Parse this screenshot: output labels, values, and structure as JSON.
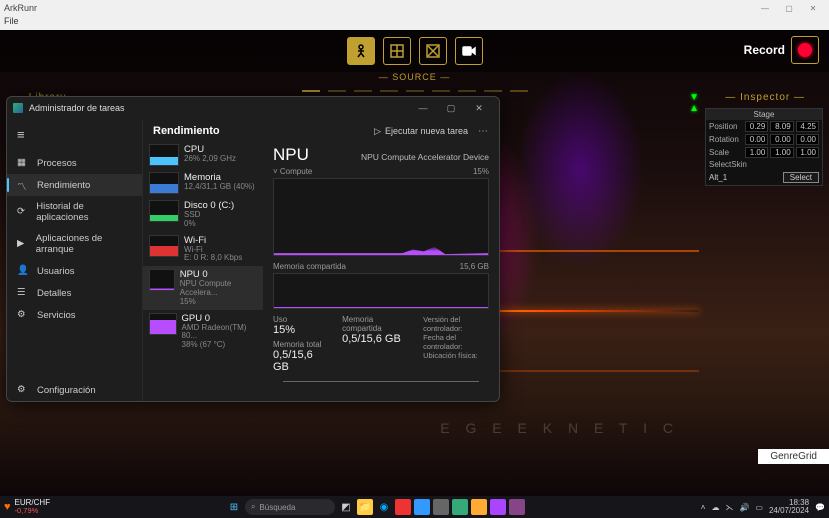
{
  "outer": {
    "title": "ArkRunr",
    "menu_file": "File"
  },
  "app": {
    "source": "— SOURCE —",
    "record": "Record",
    "library": "Library",
    "inspector": "Inspector",
    "watermark": "E   G E E K N E T I C",
    "genregrid": "GenreGrid"
  },
  "inspector": {
    "title": "Stage",
    "rows": [
      {
        "lbl": "Position",
        "v": [
          "0.29",
          "8.09",
          "4.25"
        ]
      },
      {
        "lbl": "Rotation",
        "v": [
          "0.00",
          "0.00",
          "0.00"
        ]
      },
      {
        "lbl": "Scale",
        "v": [
          "1.00",
          "1.00",
          "1.00"
        ]
      }
    ],
    "selectskin": "SelectSkin",
    "alt": "Alt_1",
    "select": "Select"
  },
  "tm": {
    "title": "Administrador de tareas",
    "head": "Rendimiento",
    "run": "Ejecutar nueva tarea",
    "nav": [
      "Procesos",
      "Rendimiento",
      "Historial de aplicaciones",
      "Aplicaciones de arranque",
      "Usuarios",
      "Detalles",
      "Servicios"
    ],
    "settings": "Configuración",
    "list": [
      {
        "t": "CPU",
        "s": "26%  2,09 GHz",
        "c": "cpu"
      },
      {
        "t": "Memoria",
        "s": "12,4/31,1 GB (40%)",
        "c": "mem"
      },
      {
        "t": "Disco 0 (C:)",
        "s": "SSD\n0%",
        "c": "disk"
      },
      {
        "t": "Wi-Fi",
        "s": "Wi-Fi\nE: 0  R: 8,0 Kbps",
        "c": "wifi"
      },
      {
        "t": "NPU 0",
        "s": "NPU Compute Accelera...\n15%",
        "c": "npu"
      },
      {
        "t": "GPU 0",
        "s": "AMD Radeon(TM) 80...\n38%  (67 °C)",
        "c": "gpu"
      }
    ],
    "detail": {
      "name": "NPU",
      "device": "NPU Compute Accelerator Device",
      "compute": "Compute",
      "pct": "15%",
      "memshared_lbl": "Memoria compartida",
      "memshared_max": "15,6 GB",
      "stats": {
        "uso_lbl": "Uso",
        "uso": "15%",
        "memc_lbl": "Memoria compartida",
        "memc": "0,5/15,6 GB",
        "memt_lbl": "Memoria total",
        "memt": "0,5/15,6 GB",
        "drv_v": "Versión del controlador:",
        "drv_d": "Fecha del controlador:",
        "loc": "Ubicación física:"
      }
    }
  },
  "taskbar": {
    "eur": "EUR/CHF",
    "eur_pct": "-0,79%",
    "search": "Búsqueda",
    "time": "18:38",
    "date": "24/07/2024"
  }
}
